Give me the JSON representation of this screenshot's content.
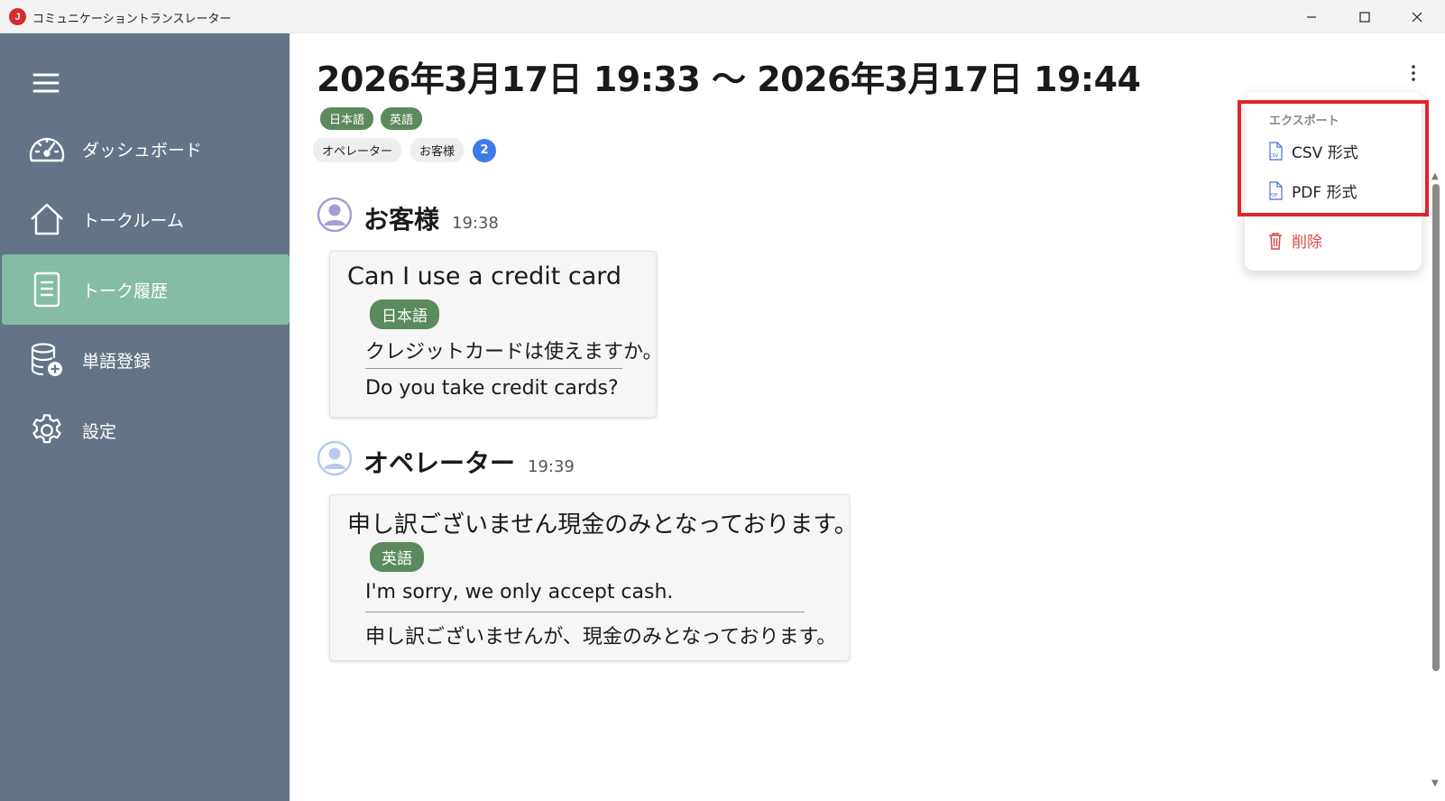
{
  "window": {
    "app_logo": "J",
    "title": "コミュニケーショントランスレーター",
    "controls": {
      "minimize": "minimize-icon",
      "maximize": "maximize-icon",
      "close": "close-icon"
    }
  },
  "sidebar": {
    "items": [
      {
        "label": "ダッシュボード",
        "icon": "dashboard-gauge-icon"
      },
      {
        "label": "トークルーム",
        "icon": "home-icon"
      },
      {
        "label": "トーク履歴",
        "icon": "document-icon",
        "active": true
      },
      {
        "label": "単語登録",
        "icon": "database-add-icon"
      },
      {
        "label": "設定",
        "icon": "gear-icon"
      }
    ]
  },
  "header": {
    "title": "2026年3月17日 19:33 〜 2026年3月17日 19:44",
    "languages": [
      "日本語",
      "英語"
    ],
    "participants": [
      "オペレーター",
      "お客様"
    ],
    "participant_count": "2"
  },
  "messages": [
    {
      "speaker": "お客様",
      "time": "19:38",
      "original": "Can I use a credit card",
      "target_language": "日本語",
      "translation": "クレジットカードは使えますか。",
      "back_translation": "Do you take credit cards?"
    },
    {
      "speaker": "オペレーター",
      "time": "19:39",
      "original": "申し訳ございません現金のみとなっております。",
      "target_language": "英語",
      "translation": "I'm sorry, we only accept cash.",
      "back_translation": "申し訳ございませんが、現金のみとなっております。"
    }
  ],
  "menu": {
    "section_header": "エクスポート",
    "csv_label": "CSV 形式",
    "pdf_label": "PDF 形式",
    "csv_icon_text": "CSV",
    "pdf_icon_text": "PDF",
    "delete_label": "削除"
  },
  "colors": {
    "sidebar_bg": "#647486",
    "active_nav": "#84bca6",
    "language_chip": "#5b8a5e",
    "count_badge": "#3f7be8",
    "delete_text": "#d84a4a",
    "highlight": "#e0242a"
  }
}
